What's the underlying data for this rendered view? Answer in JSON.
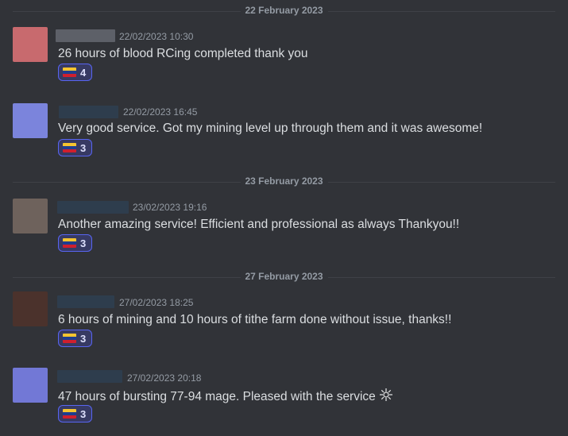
{
  "dividers": {
    "d1": "22 February 2023",
    "d2": "23 February 2023",
    "d3": "27 February 2023"
  },
  "messages": [
    {
      "timestamp": "22/02/2023 10:30",
      "text": "26 hours of blood RCing completed thank you",
      "reaction_count": "4",
      "avatar_color": "#c86a6e"
    },
    {
      "timestamp": "22/02/2023 16:45",
      "text": "Very good service. Got my mining level up through them and it was awesome!",
      "reaction_count": "3",
      "avatar_color": "#7b84dc"
    },
    {
      "timestamp": "23/02/2023 19:16",
      "text": "Another amazing service! Efficient and professional as always Thankyou!!",
      "reaction_count": "3",
      "avatar_color": "#6e625c"
    },
    {
      "timestamp": "27/02/2023 18:25",
      "text": "6 hours of mining and 10 hours of tithe farm done without issue, thanks!!",
      "reaction_count": "3",
      "avatar_color": "#4b322c"
    },
    {
      "timestamp": "27/02/2023 20:18",
      "text": "47 hours of bursting 77-94 mage. Pleased with the service",
      "reaction_count": "3",
      "avatar_color": "#7278d6"
    }
  ],
  "reaction_emoji": "venezuela-flag-icon",
  "colors": {
    "background": "#313338",
    "reaction_bg": "#373a63",
    "reaction_border": "#5865f2",
    "muted": "#949ba4"
  }
}
